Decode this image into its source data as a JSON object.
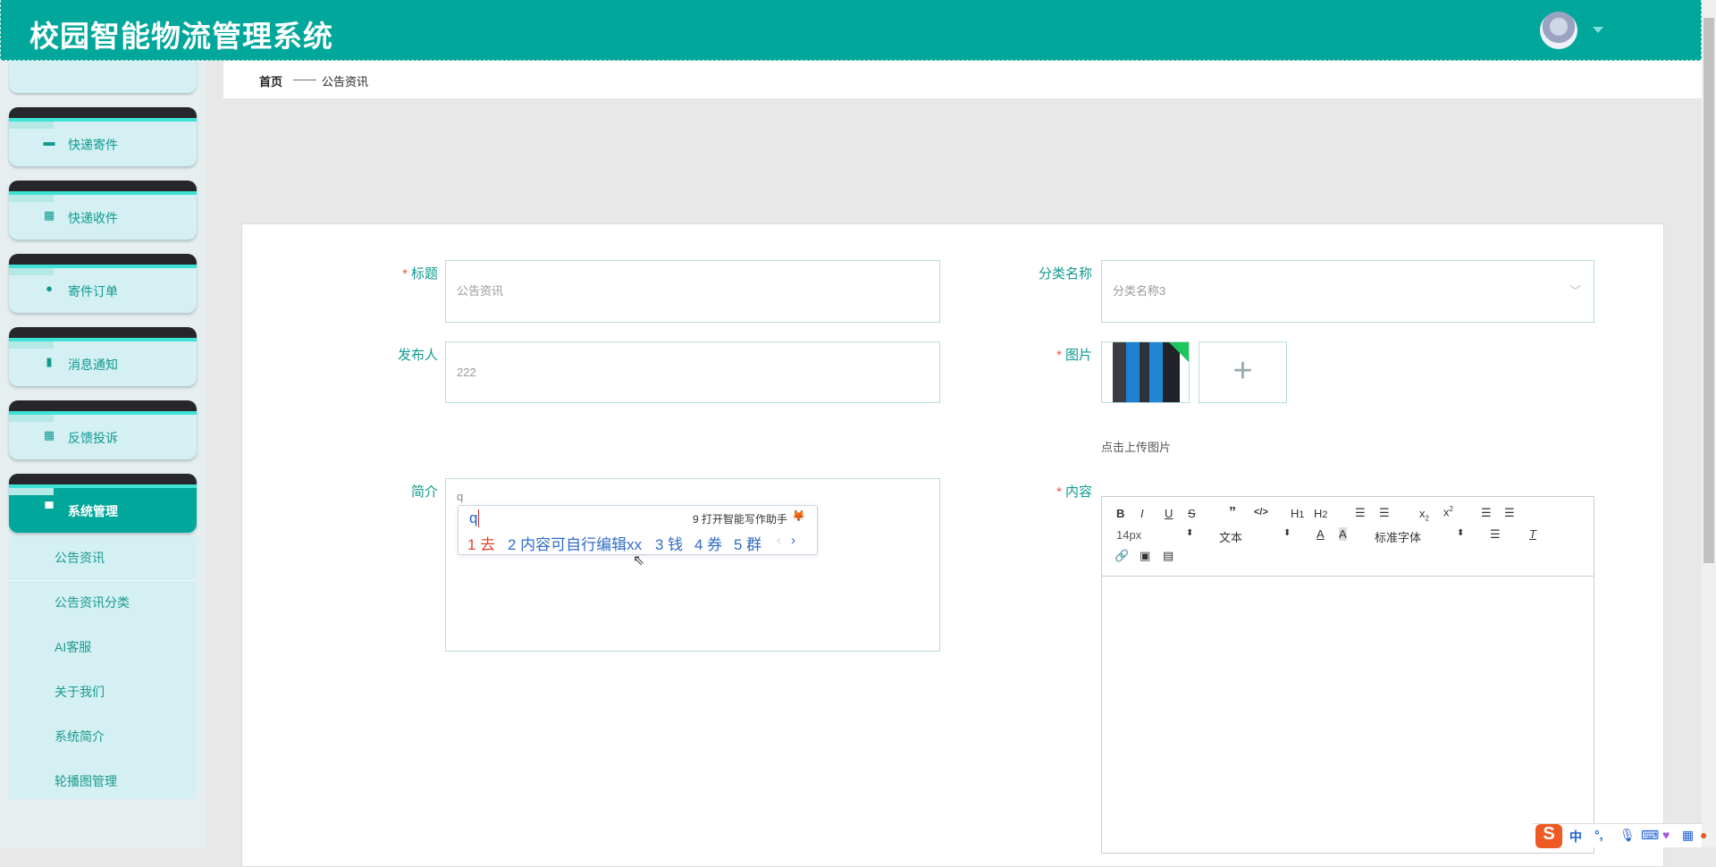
{
  "header": {
    "title": "校园智能物流管理系统"
  },
  "sidebar": {
    "items": [
      {
        "label": "快递寄件",
        "icon": "ticket-icon"
      },
      {
        "label": "快递收件",
        "icon": "grid-icon"
      },
      {
        "label": "寄件订单",
        "icon": "bulb-icon"
      },
      {
        "label": "消息通知",
        "icon": "clipboard-icon"
      },
      {
        "label": "反馈投诉",
        "icon": "grid-icon"
      },
      {
        "label": "系统管理",
        "icon": "monitor-icon",
        "active": true
      }
    ],
    "submenu": [
      "公告资讯",
      "公告资讯分类",
      "AI客服",
      "关于我们",
      "系统简介",
      "轮播图管理"
    ]
  },
  "breadcrumb": {
    "home": "首页",
    "sep": "——",
    "current": "公告资讯"
  },
  "form": {
    "title": {
      "label": "标题",
      "required": true,
      "value": "公告资讯"
    },
    "category": {
      "label": "分类名称",
      "value": "分类名称3"
    },
    "publisher": {
      "label": "发布人",
      "value": "222"
    },
    "image": {
      "label": "图片",
      "required": true,
      "hint": "点击上传图片"
    },
    "intro": {
      "label": "简介",
      "value": "q"
    },
    "content": {
      "label": "内容",
      "required": true
    }
  },
  "editor": {
    "font_size": "14px",
    "block": "文本",
    "font": "标准字体"
  },
  "ime": {
    "input": "q",
    "assistant": "9 打开智能写作助手",
    "candidates": [
      "1 去",
      "2 内容可自行编辑xx",
      "3 钱",
      "4 券",
      "5 群"
    ]
  },
  "tray": {
    "lang": "中",
    "punct": "°,"
  },
  "colors": {
    "primary": "#00a79a",
    "menu_bg": "#d4f0f3",
    "required": "#e54"
  }
}
